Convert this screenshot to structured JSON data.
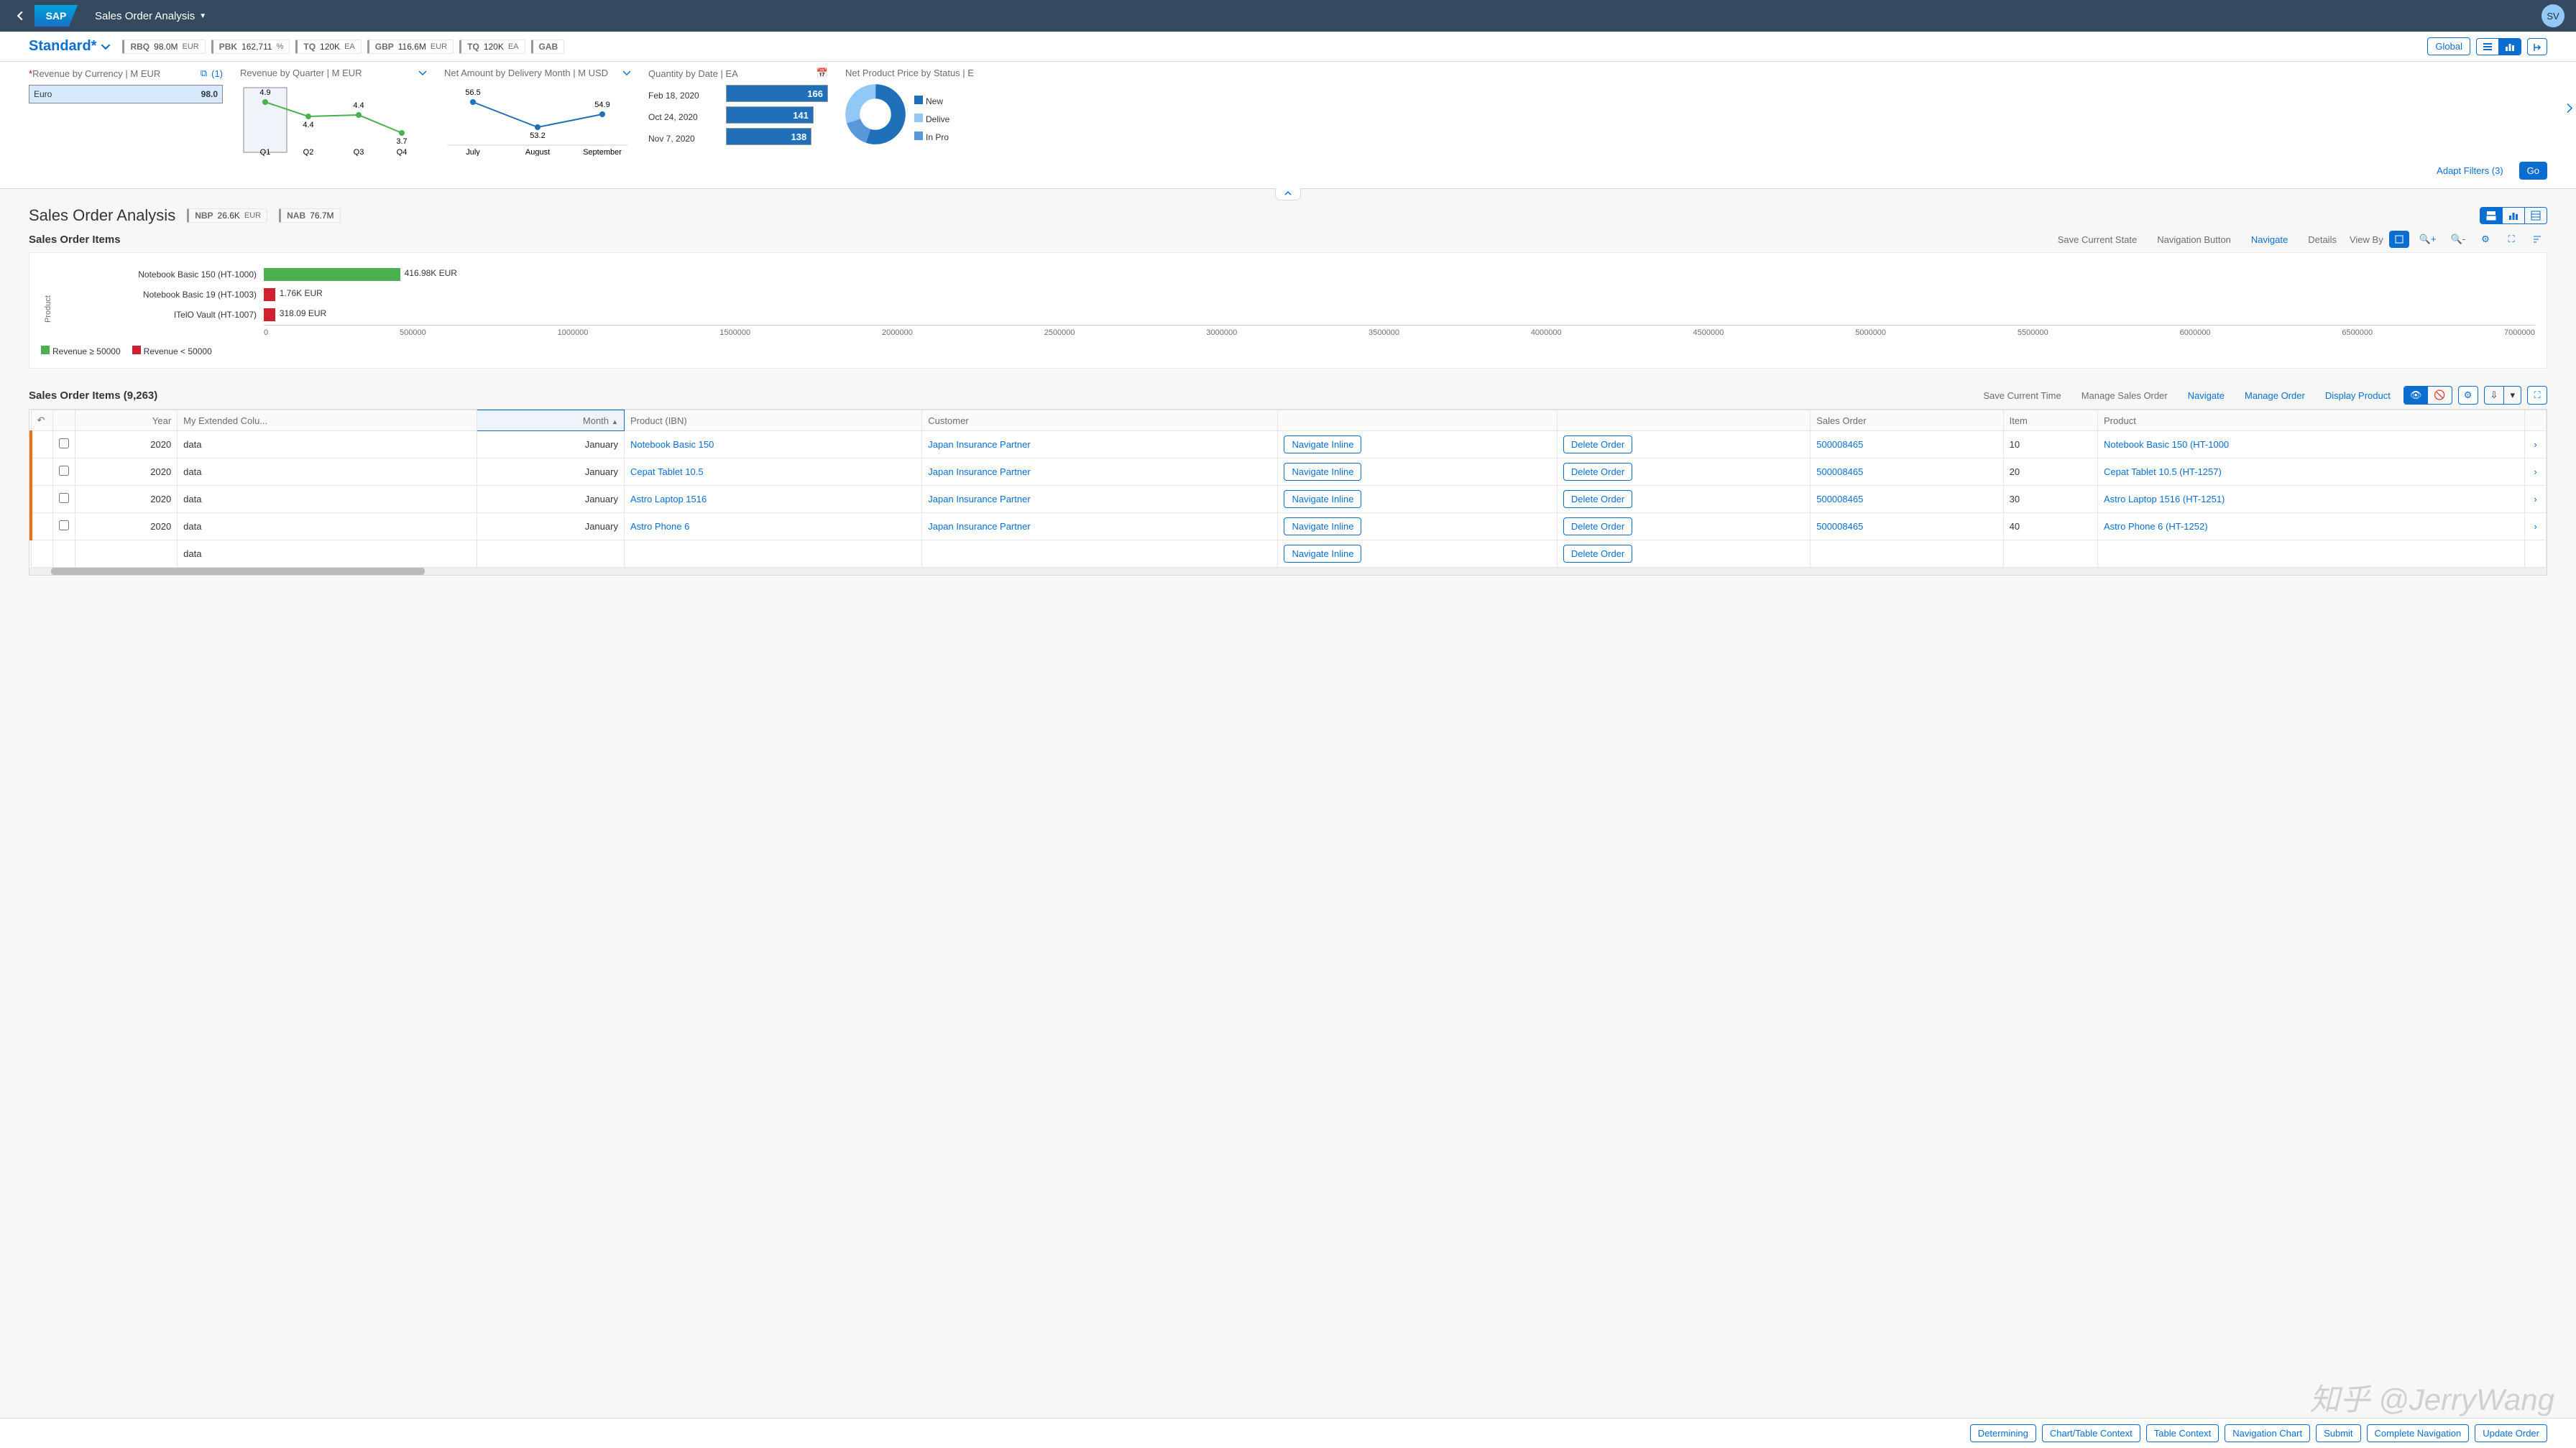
{
  "shell": {
    "title": "Sales Order Analysis",
    "avatar": "SV",
    "logo": "SAP"
  },
  "variant": {
    "name": "Standard*"
  },
  "kpis": [
    {
      "label": "RBQ",
      "value": "98.0M",
      "unit": "EUR"
    },
    {
      "label": "PBK",
      "value": "162,711",
      "unit": "%"
    },
    {
      "label": "TQ",
      "value": "120K",
      "unit": "EA"
    },
    {
      "label": "GBP",
      "value": "116.6M",
      "unit": "EUR"
    },
    {
      "label": "TQ",
      "value": "120K",
      "unit": "EA"
    },
    {
      "label": "GAB",
      "value": "",
      "unit": ""
    }
  ],
  "filter_actions": {
    "global": "Global",
    "adapt": "Adapt Filters (3)",
    "go": "Go"
  },
  "viz_revenue_currency": {
    "title": "Revenue by Currency  | M EUR",
    "count": "(1)",
    "item_label": "Euro",
    "item_value": "98.0"
  },
  "viz_revenue_quarter": {
    "title": "Revenue by Quarter  | M EUR",
    "points": [
      {
        "label": "Q1",
        "value": 4.9
      },
      {
        "label": "Q2",
        "value": 4.4
      },
      {
        "label": "Q3",
        "value": 4.4
      },
      {
        "label": "Q4",
        "value": 3.7
      }
    ]
  },
  "viz_net_amount": {
    "title": "Net Amount by Delivery Month  | M USD",
    "points": [
      {
        "label": "July",
        "value": 56.5
      },
      {
        "label": "August",
        "value": 53.2
      },
      {
        "label": "September",
        "value": 54.9
      }
    ]
  },
  "viz_quantity_date": {
    "title": "Quantity by Date  | EA",
    "rows": [
      {
        "label": "Feb 18, 2020",
        "value": "166"
      },
      {
        "label": "Oct 24, 2020",
        "value": "141"
      },
      {
        "label": "Nov 7, 2020",
        "value": "138"
      }
    ]
  },
  "viz_net_price": {
    "title": "Net Product Price by Status  | E",
    "legend": [
      {
        "label": "New",
        "color": "#1f6fb9"
      },
      {
        "label": "Delive",
        "color": "#91c8f6"
      },
      {
        "label": "In Pro",
        "color": "#5899da"
      }
    ]
  },
  "section": {
    "title": "Sales Order Analysis",
    "kpi1": {
      "label": "NBP",
      "value": "26.6K",
      "unit": "EUR"
    },
    "kpi2": {
      "label": "NAB",
      "value": "76.7M",
      "unit": ""
    }
  },
  "items_header": {
    "title": "Sales Order Items",
    "actions": {
      "save_state": "Save Current State",
      "nav_button": "Navigation Button",
      "navigate": "Navigate",
      "details": "Details",
      "view_by": "View By"
    }
  },
  "chart_data": {
    "type": "bar",
    "orientation": "horizontal",
    "xlabel": "",
    "ylabel": "Product",
    "xlim": [
      0,
      7000000
    ],
    "xticks": [
      0,
      500000,
      1000000,
      1500000,
      2000000,
      2500000,
      3000000,
      3500000,
      4000000,
      4500000,
      5000000,
      5500000,
      6000000,
      6500000,
      7000000
    ],
    "series": [
      {
        "name": "Notebook Basic 150 (HT-1000)",
        "value": 416980,
        "display": "416.98K EUR",
        "color": "#4caf50"
      },
      {
        "name": "Notebook Basic 19 (HT-1003)",
        "value": 1760,
        "display": "1.76K EUR",
        "color": "#b00"
      },
      {
        "name": "ITelO Vault (HT-1007)",
        "value": 318090,
        "display": "318.09 EUR",
        "color": "#b00"
      }
    ],
    "legend": [
      {
        "label": "Revenue ≥ 50000",
        "color": "#4caf50"
      },
      {
        "label": "Revenue < 50000",
        "color": "#d32030"
      }
    ]
  },
  "table": {
    "title": "Sales Order Items (9,263)",
    "toolbar": {
      "save_time": "Save Current Time",
      "manage": "Manage Sales Order",
      "navigate": "Navigate",
      "manage_order": "Manage Order",
      "display_product": "Display Product"
    },
    "columns": {
      "year": "Year",
      "ext": "My Extended Colu...",
      "month": "Month",
      "product_ibn": "Product (IBN)",
      "customer": "Customer",
      "sales_order": "Sales Order",
      "item": "Item",
      "product": "Product"
    },
    "nav_inline": "Navigate Inline",
    "delete_order": "Delete Order",
    "rows": [
      {
        "year": "2020",
        "ext": "data",
        "month": "January",
        "product_ibn": "Notebook Basic 150",
        "customer": "Japan Insurance Partner",
        "so": "500008465",
        "item": "10",
        "product": "Notebook Basic 150 (HT-1000"
      },
      {
        "year": "2020",
        "ext": "data",
        "month": "January",
        "product_ibn": "Cepat Tablet 10.5",
        "customer": "Japan Insurance Partner",
        "so": "500008465",
        "item": "20",
        "product": "Cepat Tablet 10.5 (HT-1257)"
      },
      {
        "year": "2020",
        "ext": "data",
        "month": "January",
        "product_ibn": "Astro Laptop 1516",
        "customer": "Japan Insurance Partner",
        "so": "500008465",
        "item": "30",
        "product": "Astro Laptop 1516 (HT-1251)"
      },
      {
        "year": "2020",
        "ext": "data",
        "month": "January",
        "product_ibn": "Astro Phone 6",
        "customer": "Japan Insurance Partner",
        "so": "500008465",
        "item": "40",
        "product": "Astro Phone 6 (HT-1252)"
      },
      {
        "year": "",
        "ext": "data",
        "month": "",
        "product_ibn": "",
        "customer": "",
        "so": "",
        "item": "",
        "product": ""
      }
    ]
  },
  "footer": {
    "determining": "Determining",
    "chart_context": "Chart/Table Context",
    "table_context": "Table Context",
    "nav_chart": "Navigation Chart",
    "submit": "Submit",
    "complete_nav": "Complete Navigation",
    "update_order": "Update Order"
  },
  "watermark": "知乎 @JerryWang"
}
